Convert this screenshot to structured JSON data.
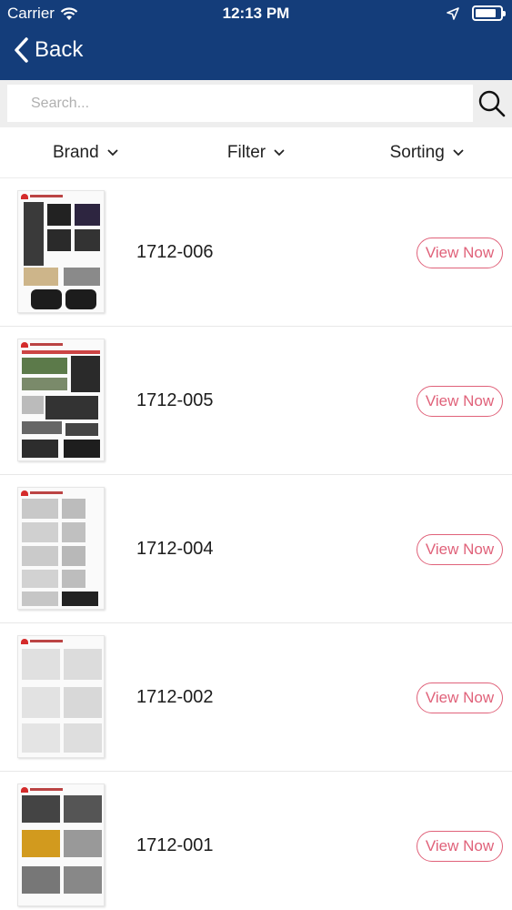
{
  "status_bar": {
    "carrier": "Carrier",
    "time": "12:13 PM"
  },
  "nav": {
    "back_label": "Back"
  },
  "search": {
    "placeholder": "Search...",
    "value": ""
  },
  "filters": {
    "brand": "Brand",
    "filter": "Filter",
    "sorting": "Sorting"
  },
  "items": [
    {
      "title": "1712-006",
      "button": "View Now"
    },
    {
      "title": "1712-005",
      "button": "View Now"
    },
    {
      "title": "1712-004",
      "button": "View Now"
    },
    {
      "title": "1712-002",
      "button": "View Now"
    },
    {
      "title": "1712-001",
      "button": "View Now"
    }
  ],
  "colors": {
    "header_bg": "#143d7a",
    "accent": "#e0627a",
    "search_bg": "#eeeeee"
  }
}
